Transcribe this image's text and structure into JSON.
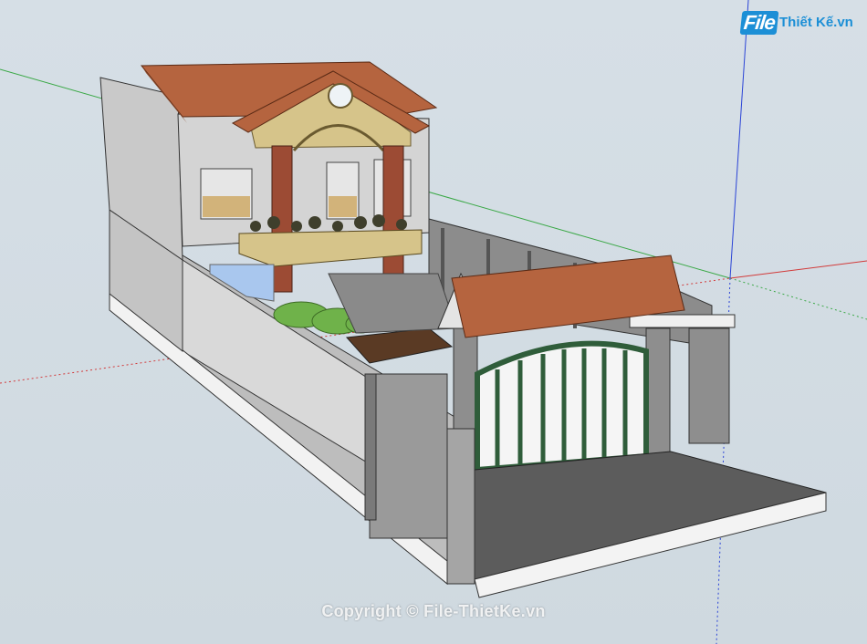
{
  "app": {
    "name": "SketchUp model viewport"
  },
  "logo": {
    "brand": "File",
    "rest": "Thiết Kế.vn"
  },
  "watermark": {
    "text": "Copyright © File-ThietKe.vn"
  },
  "colors": {
    "background": "#d3dde4",
    "axis_red": "#d23a3a",
    "axis_green": "#3aa846",
    "axis_blue": "#2b44d6",
    "roof": "#b5643f",
    "wall": "#cfcfcf",
    "gate": "#2f5d3a",
    "paving": "#5c5c5c",
    "brick_pillar": "#8e8e8e",
    "gable": "#d6c48a"
  },
  "scene": {
    "subject": "two-story townhouse model with tiled roofs, balcony planters, front gate with tiled canopy and paved forecourt",
    "axes": [
      "red-axis",
      "green-axis",
      "blue-axis"
    ]
  }
}
